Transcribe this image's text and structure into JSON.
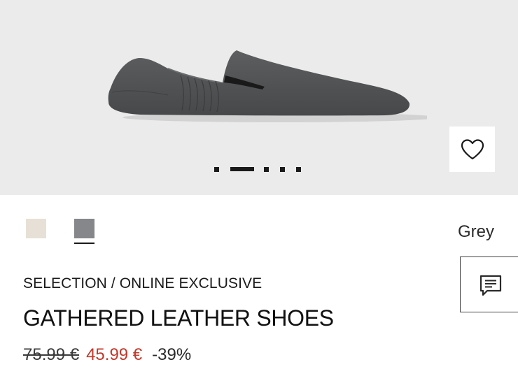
{
  "product": {
    "image_alt": "shoe-image",
    "gallery": {
      "dot_count": 5,
      "active_index": 1
    },
    "wishlist_icon": "heart-icon",
    "colors": {
      "options": [
        {
          "name": "beige",
          "hex": "#e6e0d6"
        },
        {
          "name": "grey",
          "hex": "#85878a"
        }
      ],
      "selected_index": 1,
      "selected_label": "Grey"
    },
    "chat_icon": "chat-icon",
    "breadcrumb": "SELECTION / ONLINE EXCLUSIVE",
    "title": "GATHERED LEATHER SHOES",
    "price_old": "75.99 €",
    "price_new": "45.99 €",
    "discount": "-39%"
  },
  "colors": {
    "hero_bg": "#ebebeb",
    "sale": "#c0392b",
    "shoe": "#4f5153"
  }
}
